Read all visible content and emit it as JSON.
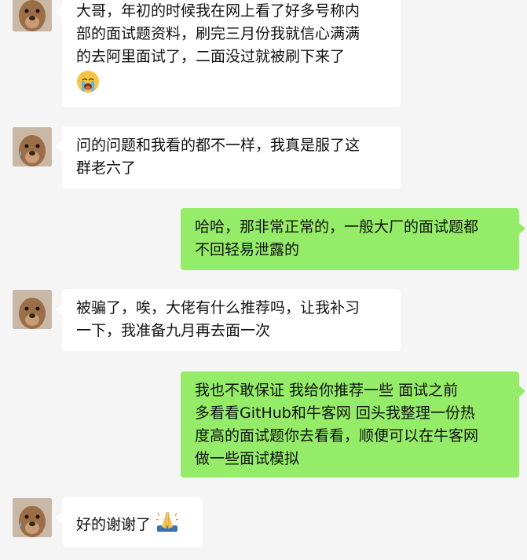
{
  "chat": {
    "messages": [
      {
        "side": "left",
        "lines": [
          "大哥，年初的时候我在网上看了好多号称内",
          "部的面试题资料，刷完三月份我就信心满满",
          "的去阿里面试了，二面没过就被刷下来了"
        ],
        "emoji": "crying-face-emoji"
      },
      {
        "side": "left",
        "lines": [
          "问的问题和我看的都不一样，我真是服了这",
          "群老六了"
        ]
      },
      {
        "side": "right",
        "lines": [
          "哈哈，那非常正常的，一般大厂的面试题都",
          "不回轻易泄露的"
        ]
      },
      {
        "side": "left",
        "lines": [
          "被骗了，唉，大佬有什么推荐吗，让我补习",
          "一下，我准备九月再去面一次"
        ]
      },
      {
        "side": "right",
        "lines": [
          "我也不敢保证  我给你推荐一些  面试之前",
          "多看看GitHub和牛客网  回头我整理一份热",
          "度高的面试题你去看看，顺便可以在牛客网",
          "做一些面试模拟"
        ]
      },
      {
        "side": "left",
        "lines": [
          "好的谢谢了"
        ],
        "emoji": "folded-hands-emoji"
      }
    ]
  },
  "colors": {
    "background": "#f5f5f5",
    "left_bubble": "#ffffff",
    "right_bubble": "#95ec69",
    "text": "#111111"
  }
}
